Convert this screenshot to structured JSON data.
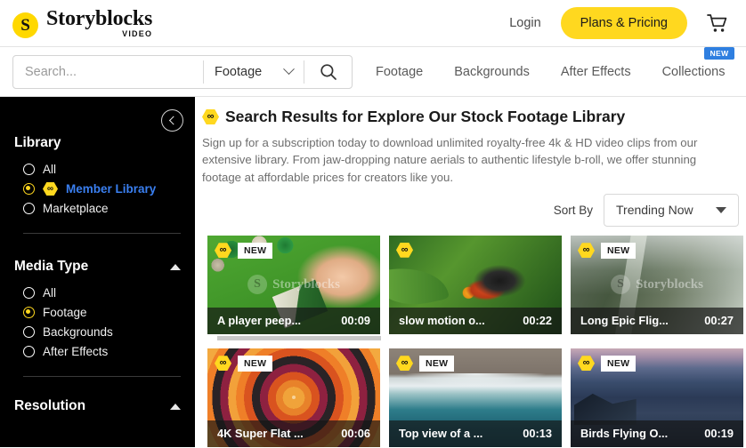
{
  "header": {
    "logo_mark": "S",
    "logo_word": "Storyblocks",
    "logo_sub": "VIDEO",
    "login_label": "Login",
    "plans_label": "Plans & Pricing",
    "cart_icon": "shopping-cart-icon"
  },
  "search": {
    "placeholder": "Search...",
    "value": "",
    "category": "Footage",
    "submit_icon": "magnifier-icon"
  },
  "nav": {
    "links": [
      {
        "label": "Footage",
        "badge": ""
      },
      {
        "label": "Backgrounds",
        "badge": ""
      },
      {
        "label": "After Effects",
        "badge": ""
      },
      {
        "label": "Collections",
        "badge": "NEW"
      }
    ]
  },
  "sidebar": {
    "collapse_icon": "chevron-left-circle-icon",
    "sections": [
      {
        "title": "Library",
        "collapsible": false,
        "options": [
          {
            "label": "All",
            "selected": false,
            "hex": false
          },
          {
            "label": "Member Library",
            "selected": true,
            "hex": true
          },
          {
            "label": "Marketplace",
            "selected": false,
            "hex": false
          }
        ]
      },
      {
        "title": "Media Type",
        "collapsible": true,
        "caret": "caret-up-icon",
        "options": [
          {
            "label": "All",
            "selected": false,
            "hex": false
          },
          {
            "label": "Footage",
            "selected": true,
            "hex": false
          },
          {
            "label": "Backgrounds",
            "selected": false,
            "hex": false
          },
          {
            "label": "After Effects",
            "selected": false,
            "hex": false
          }
        ]
      },
      {
        "title": "Resolution",
        "collapsible": true,
        "caret": "caret-up-icon",
        "options": []
      }
    ]
  },
  "main": {
    "title_icon": "infinity-hex-icon",
    "title": "Search Results for Explore Our Stock Footage Library",
    "description": "Sign up for a subscription today to download unlimited royalty-free 4k & HD video clips from our extensive library. From jaw-dropping nature aerials to authentic lifestyle b-roll, we offer stunning footage at affordable prices for creators like you.",
    "sort_label": "Sort By",
    "sort_value": "Trending Now",
    "watermark": "Storyblocks",
    "cards": [
      {
        "title": "A player peep...",
        "duration": "00:09",
        "new": true,
        "member": true,
        "watermark": true,
        "thumb": "t1"
      },
      {
        "title": "slow motion o...",
        "duration": "00:22",
        "new": false,
        "member": true,
        "watermark": false,
        "thumb": "t2"
      },
      {
        "title": "Long Epic Flig...",
        "duration": "00:27",
        "new": true,
        "member": true,
        "watermark": true,
        "thumb": "t3"
      },
      {
        "title": "4K Super Flat ...",
        "duration": "00:06",
        "new": true,
        "member": true,
        "watermark": false,
        "thumb": "t4"
      },
      {
        "title": "Top view of a ...",
        "duration": "00:13",
        "new": true,
        "member": true,
        "watermark": false,
        "thumb": "t5"
      },
      {
        "title": "Birds Flying O...",
        "duration": "00:19",
        "new": true,
        "member": true,
        "watermark": false,
        "thumb": "t6"
      }
    ]
  },
  "colors": {
    "brand_yellow": "#ffd81f",
    "member_blue": "#3a7ff0",
    "new_badge_blue": "#2f7fe0",
    "sidebar_bg": "#000000"
  }
}
